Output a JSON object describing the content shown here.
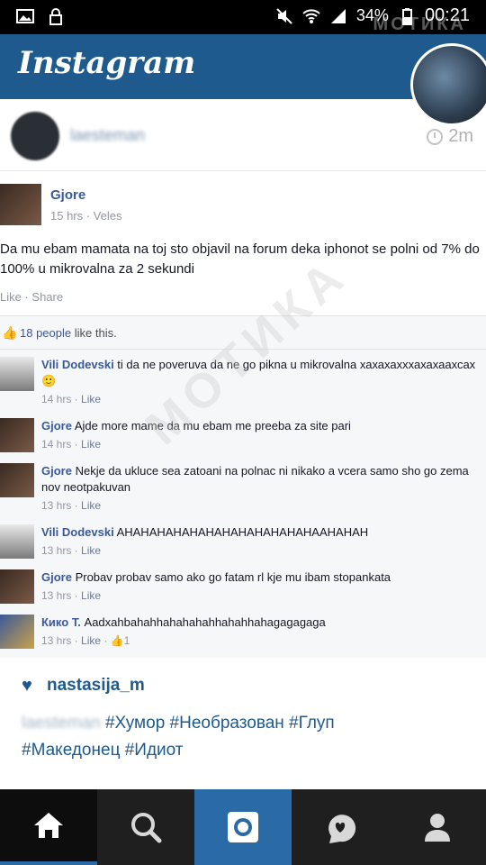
{
  "status_bar": {
    "battery": "34%",
    "time": "00:21"
  },
  "watermark": "МОТИКА",
  "header": {
    "logo": "Instagram"
  },
  "post": {
    "username": "laesteman",
    "time": "2m"
  },
  "screenshot": {
    "author": "Gjore",
    "meta": "15 hrs · Veles",
    "text": "Da mu ebam mamata na toj sto objavil na forum deka iphonot se polni od 7% do 100% u mikrovalna za 2 sekundi",
    "actions": "Like · Share",
    "likes": {
      "count": "18 people",
      "suffix": " like this."
    },
    "comments": [
      {
        "name": "Vili Dodevski",
        "text": " ti da ne poveruva da ne go pikna u mikrovalna хахахахххахахаахсах 🙂",
        "meta": "14 hrs · ",
        "like": "Like",
        "extra": ""
      },
      {
        "name": "Gjore",
        "text": " Ajde more mame da mu ebam me preeba za site pari",
        "meta": "14 hrs · ",
        "like": "Like",
        "extra": ""
      },
      {
        "name": "Gjore",
        "text": " Nekje da ukluce sea zatoani na polnac ni nikako a vcera samo sho go zema nov neotpakuvan",
        "meta": "13 hrs · ",
        "like": "Like",
        "extra": ""
      },
      {
        "name": "Vili Dodevski",
        "text": " AHAHAHAHAHAHAHAHAHAHAHAHAAHAHAH",
        "meta": "13 hrs · ",
        "like": "Like",
        "extra": ""
      },
      {
        "name": "Gjore",
        "text": " Probav probav samo ako go fatam rl kje mu ibam stopankata",
        "meta": "13 hrs · ",
        "like": "Like",
        "extra": ""
      },
      {
        "name": "Кико Т.",
        "text": " Aadxahbahahhahahahahhahahhahagagagaga",
        "meta": "13 hrs · ",
        "like": "Like",
        "extra": " · 👍1"
      }
    ]
  },
  "caption": {
    "liked_by": "nastasija_m",
    "user": "laesteman",
    "line1": " #Хумор #Необразован #Глуп",
    "line2": "#Македонец #Идиот"
  },
  "nav": {
    "items": [
      "home",
      "search",
      "camera",
      "activity",
      "profile"
    ]
  },
  "colors": {
    "brand_blue": "#1e5a8e",
    "fb_blue": "#3b5998"
  }
}
